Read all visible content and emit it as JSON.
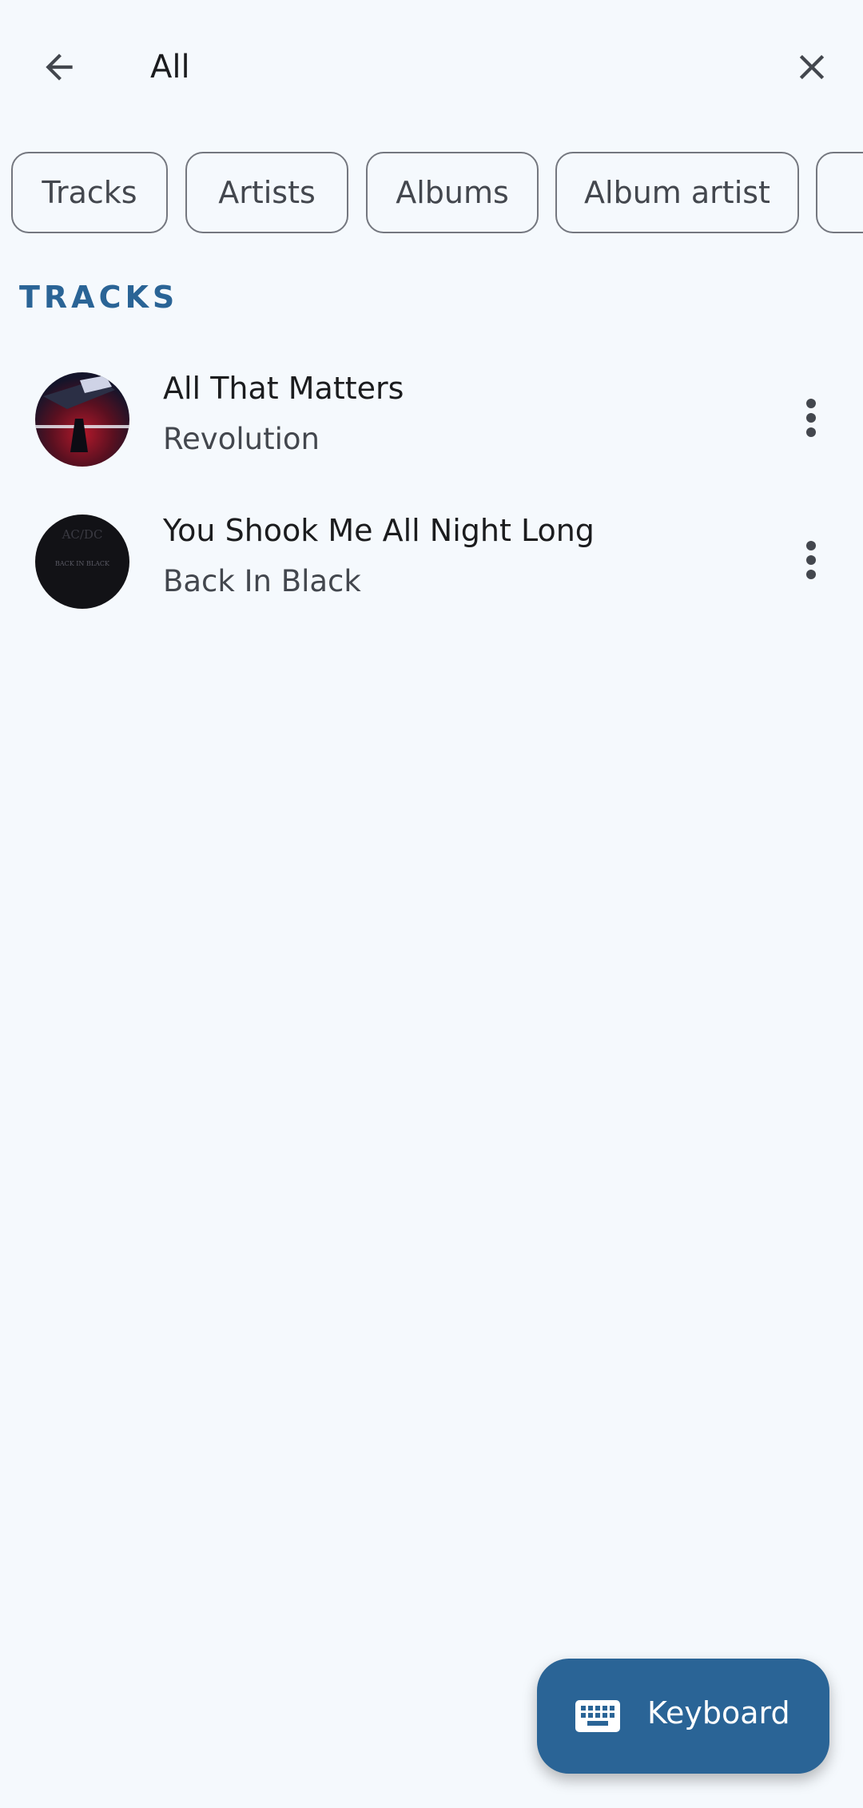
{
  "search": {
    "query": "All"
  },
  "filters": [
    {
      "label": "Tracks"
    },
    {
      "label": "Artists"
    },
    {
      "label": "Albums"
    },
    {
      "label": "Album artist"
    }
  ],
  "section": {
    "title": "TRACKS"
  },
  "tracks": [
    {
      "title": "All That Matters",
      "album": "Revolution",
      "art_icon": "revolution-album-art"
    },
    {
      "title": "You Shook Me All Night Long",
      "album": "Back In Black",
      "art_icon": "back-in-black-album-art"
    }
  ],
  "fab": {
    "label": "Keyboard",
    "icon": "keyboard-icon"
  },
  "colors": {
    "accent": "#2a6496",
    "background": "#f5f9fd",
    "outline": "#74777f"
  }
}
